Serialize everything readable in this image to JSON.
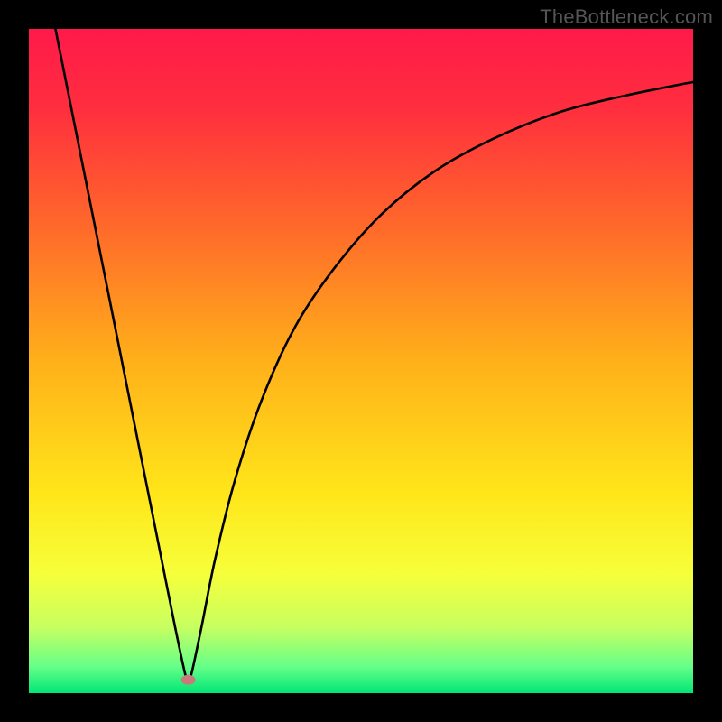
{
  "watermark": "TheBottleneck.com",
  "chart_data": {
    "type": "line",
    "title": "",
    "xlabel": "",
    "ylabel": "",
    "xlim": [
      0,
      100
    ],
    "ylim": [
      0,
      100
    ],
    "grid": false,
    "legend": false,
    "background_gradient": {
      "stops": [
        {
          "pos": 0.0,
          "color": "#ff1a4a"
        },
        {
          "pos": 0.12,
          "color": "#ff2e3e"
        },
        {
          "pos": 0.3,
          "color": "#ff6a2a"
        },
        {
          "pos": 0.5,
          "color": "#ffb01a"
        },
        {
          "pos": 0.7,
          "color": "#ffe61a"
        },
        {
          "pos": 0.82,
          "color": "#f6ff3a"
        },
        {
          "pos": 0.9,
          "color": "#c8ff60"
        },
        {
          "pos": 0.96,
          "color": "#66ff88"
        },
        {
          "pos": 1.0,
          "color": "#00e676"
        }
      ]
    },
    "minimum_marker": {
      "x": 24,
      "y": 2,
      "color": "#c97b7b"
    },
    "series": [
      {
        "name": "curve",
        "type": "line",
        "color": "#000000",
        "points": [
          {
            "x": 4.0,
            "y": 100.0
          },
          {
            "x": 6.0,
            "y": 90.0
          },
          {
            "x": 8.0,
            "y": 80.0
          },
          {
            "x": 10.0,
            "y": 70.0
          },
          {
            "x": 12.0,
            "y": 60.0
          },
          {
            "x": 14.0,
            "y": 50.0
          },
          {
            "x": 16.0,
            "y": 40.0
          },
          {
            "x": 18.0,
            "y": 30.0
          },
          {
            "x": 20.0,
            "y": 20.0
          },
          {
            "x": 22.0,
            "y": 10.0
          },
          {
            "x": 23.5,
            "y": 3.0
          },
          {
            "x": 24.0,
            "y": 2.0
          },
          {
            "x": 24.5,
            "y": 3.0
          },
          {
            "x": 26.0,
            "y": 10.0
          },
          {
            "x": 28.0,
            "y": 20.0
          },
          {
            "x": 31.0,
            "y": 32.0
          },
          {
            "x": 35.0,
            "y": 44.0
          },
          {
            "x": 40.0,
            "y": 55.0
          },
          {
            "x": 46.0,
            "y": 64.0
          },
          {
            "x": 53.0,
            "y": 72.0
          },
          {
            "x": 61.0,
            "y": 78.5
          },
          {
            "x": 70.0,
            "y": 83.5
          },
          {
            "x": 80.0,
            "y": 87.5
          },
          {
            "x": 90.0,
            "y": 90.0
          },
          {
            "x": 100.0,
            "y": 92.0
          }
        ]
      }
    ]
  }
}
